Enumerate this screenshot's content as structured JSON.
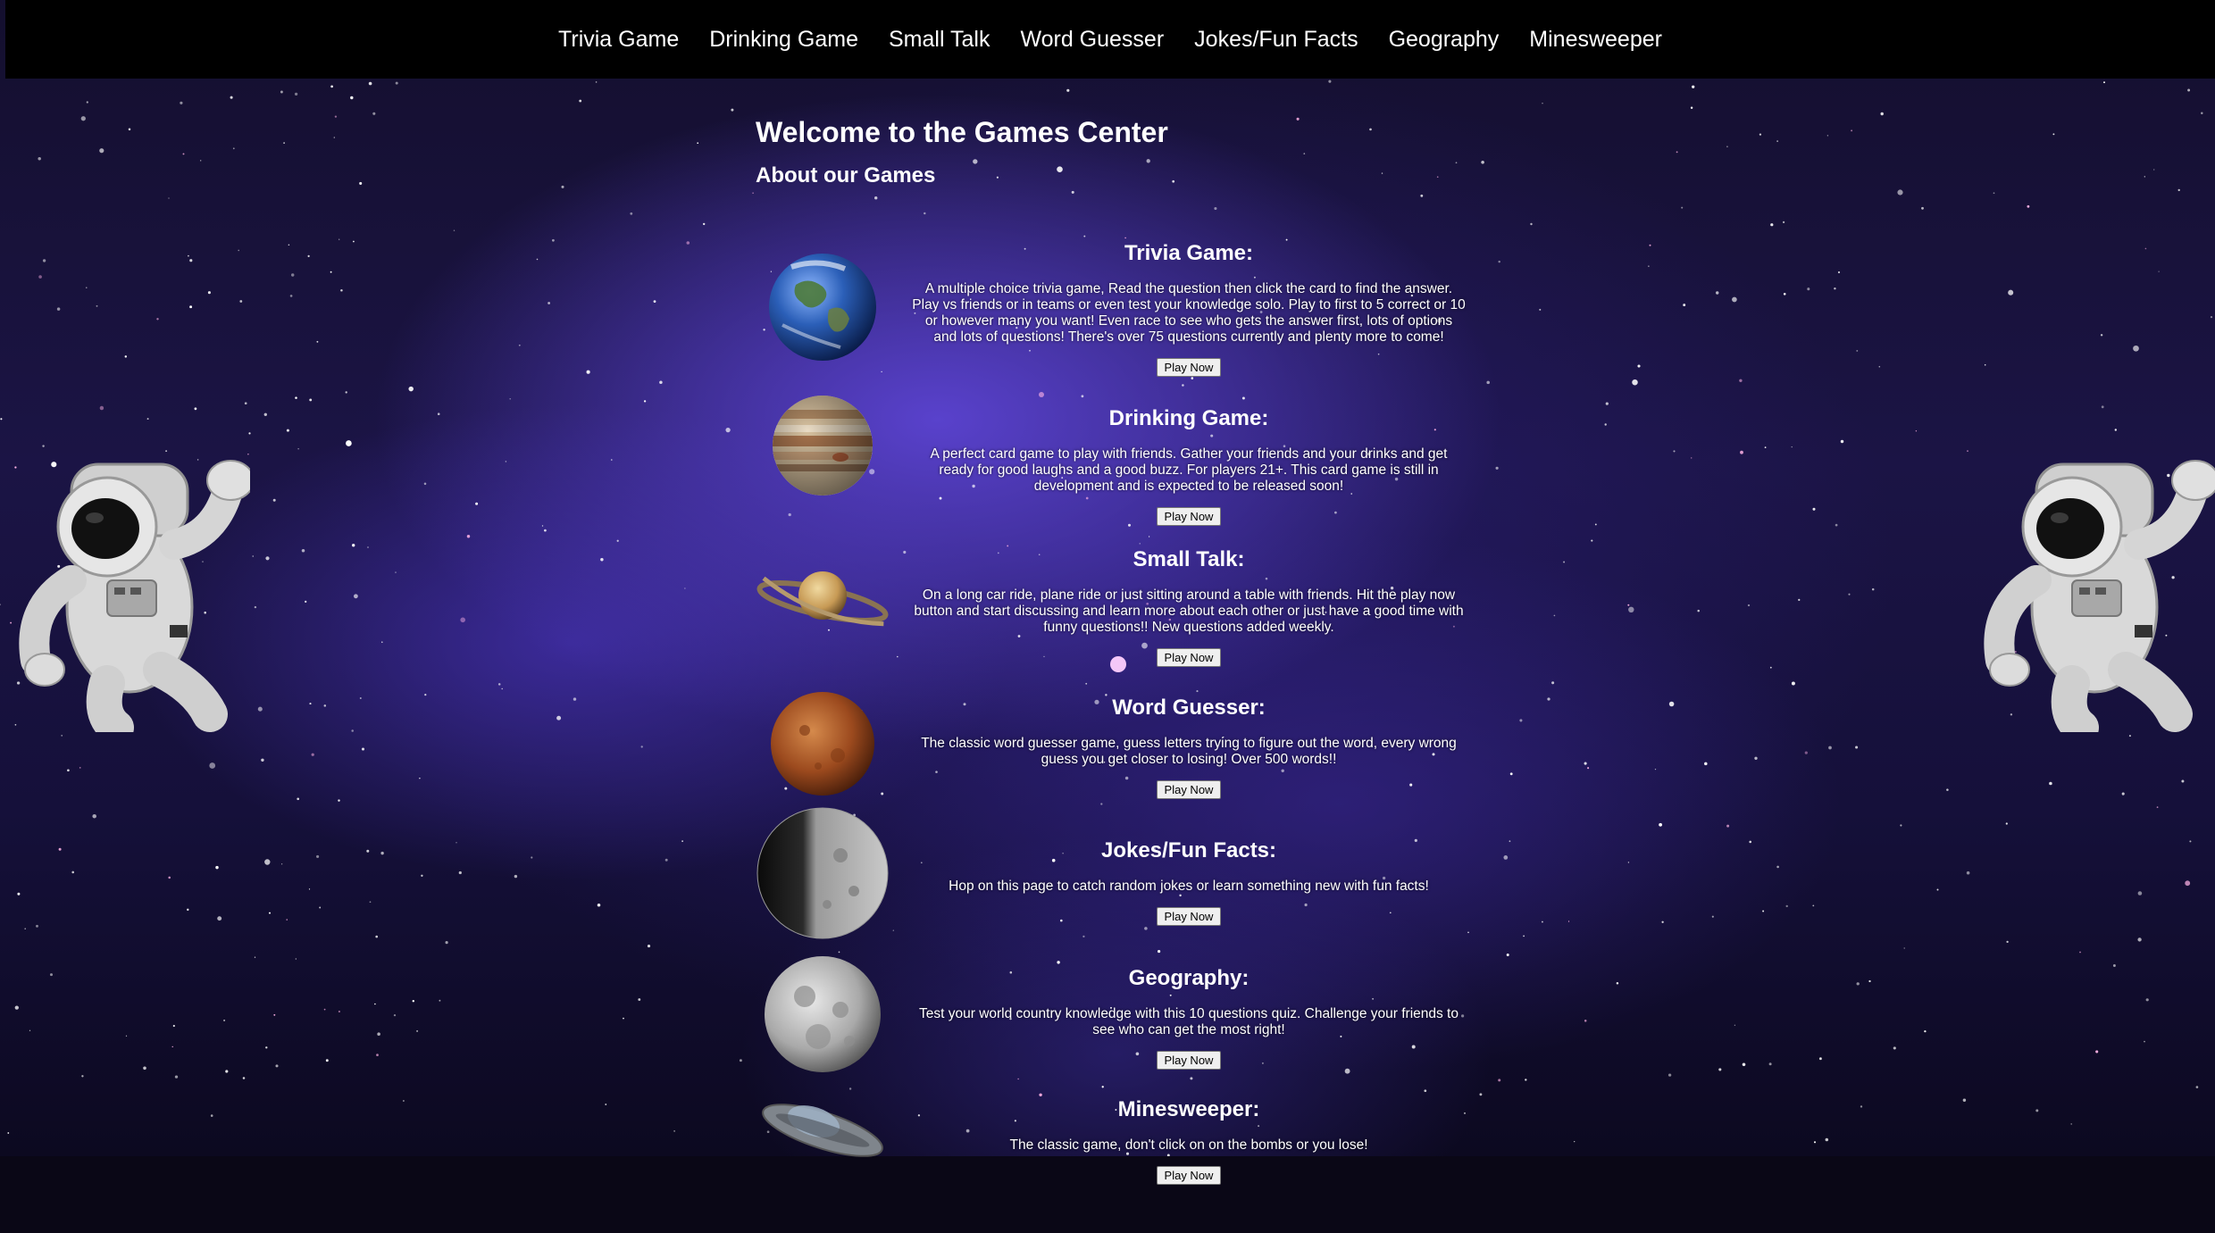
{
  "nav": {
    "items": [
      {
        "label": "Trivia Game"
      },
      {
        "label": "Drinking Game"
      },
      {
        "label": "Small Talk"
      },
      {
        "label": "Word Guesser"
      },
      {
        "label": "Jokes/Fun Facts"
      },
      {
        "label": "Geography"
      },
      {
        "label": "Minesweeper"
      }
    ]
  },
  "main": {
    "title": "Welcome to the Games Center",
    "subtitle": "About our Games"
  },
  "games": [
    {
      "name": "Trivia Game:",
      "image": "earth-planet",
      "description": "A multiple choice trivia game, Read the question then click the card to find the answer. Play vs friends or in teams or even test your knowledge solo. Play to first to 5 correct or 10 or however many you want! Even race to see who gets the answer first, lots of options and lots of questions! There's over 75 questions currently and plenty more to come!",
      "button": "Play Now"
    },
    {
      "name": "Drinking Game:",
      "image": "jupiter-planet",
      "description": "A perfect card game to play with friends. Gather your friends and your drinks and get ready for good laughs and a good buzz. For players 21+. This card game is still in development and is expected to be released soon!",
      "button": "Play Now"
    },
    {
      "name": "Small Talk:",
      "image": "saturn-planet",
      "description": "On a long car ride, plane ride or just sitting around a table with friends. Hit the play now button and start discussing and learn more about each other or just have a good time with funny questions!! New questions added weekly.",
      "button": "Play Now"
    },
    {
      "name": "Word Guesser:",
      "image": "mars-planet",
      "description": "The classic word guesser game, guess letters trying to figure out the word, every wrong guess you get closer to losing! Over 500 words!!",
      "button": "Play Now"
    },
    {
      "name": "Jokes/Fun Facts:",
      "image": "mercury-planet",
      "description": "Hop on this page to catch random jokes or learn something new with fun facts!",
      "button": "Play Now"
    },
    {
      "name": "Geography:",
      "image": "moon",
      "description": "Test your world country knowledge with this 10 questions quiz. Challenge your friends to see who can get the most right!",
      "button": "Play Now"
    },
    {
      "name": "Minesweeper:",
      "image": "ufo",
      "description": "The classic game, don't click on on the bombs or you lose!",
      "button": "Play Now"
    }
  ],
  "colors": {
    "navbar_bg": "#000000",
    "text": "#ffffff",
    "space_purple": "#5c44d2"
  }
}
